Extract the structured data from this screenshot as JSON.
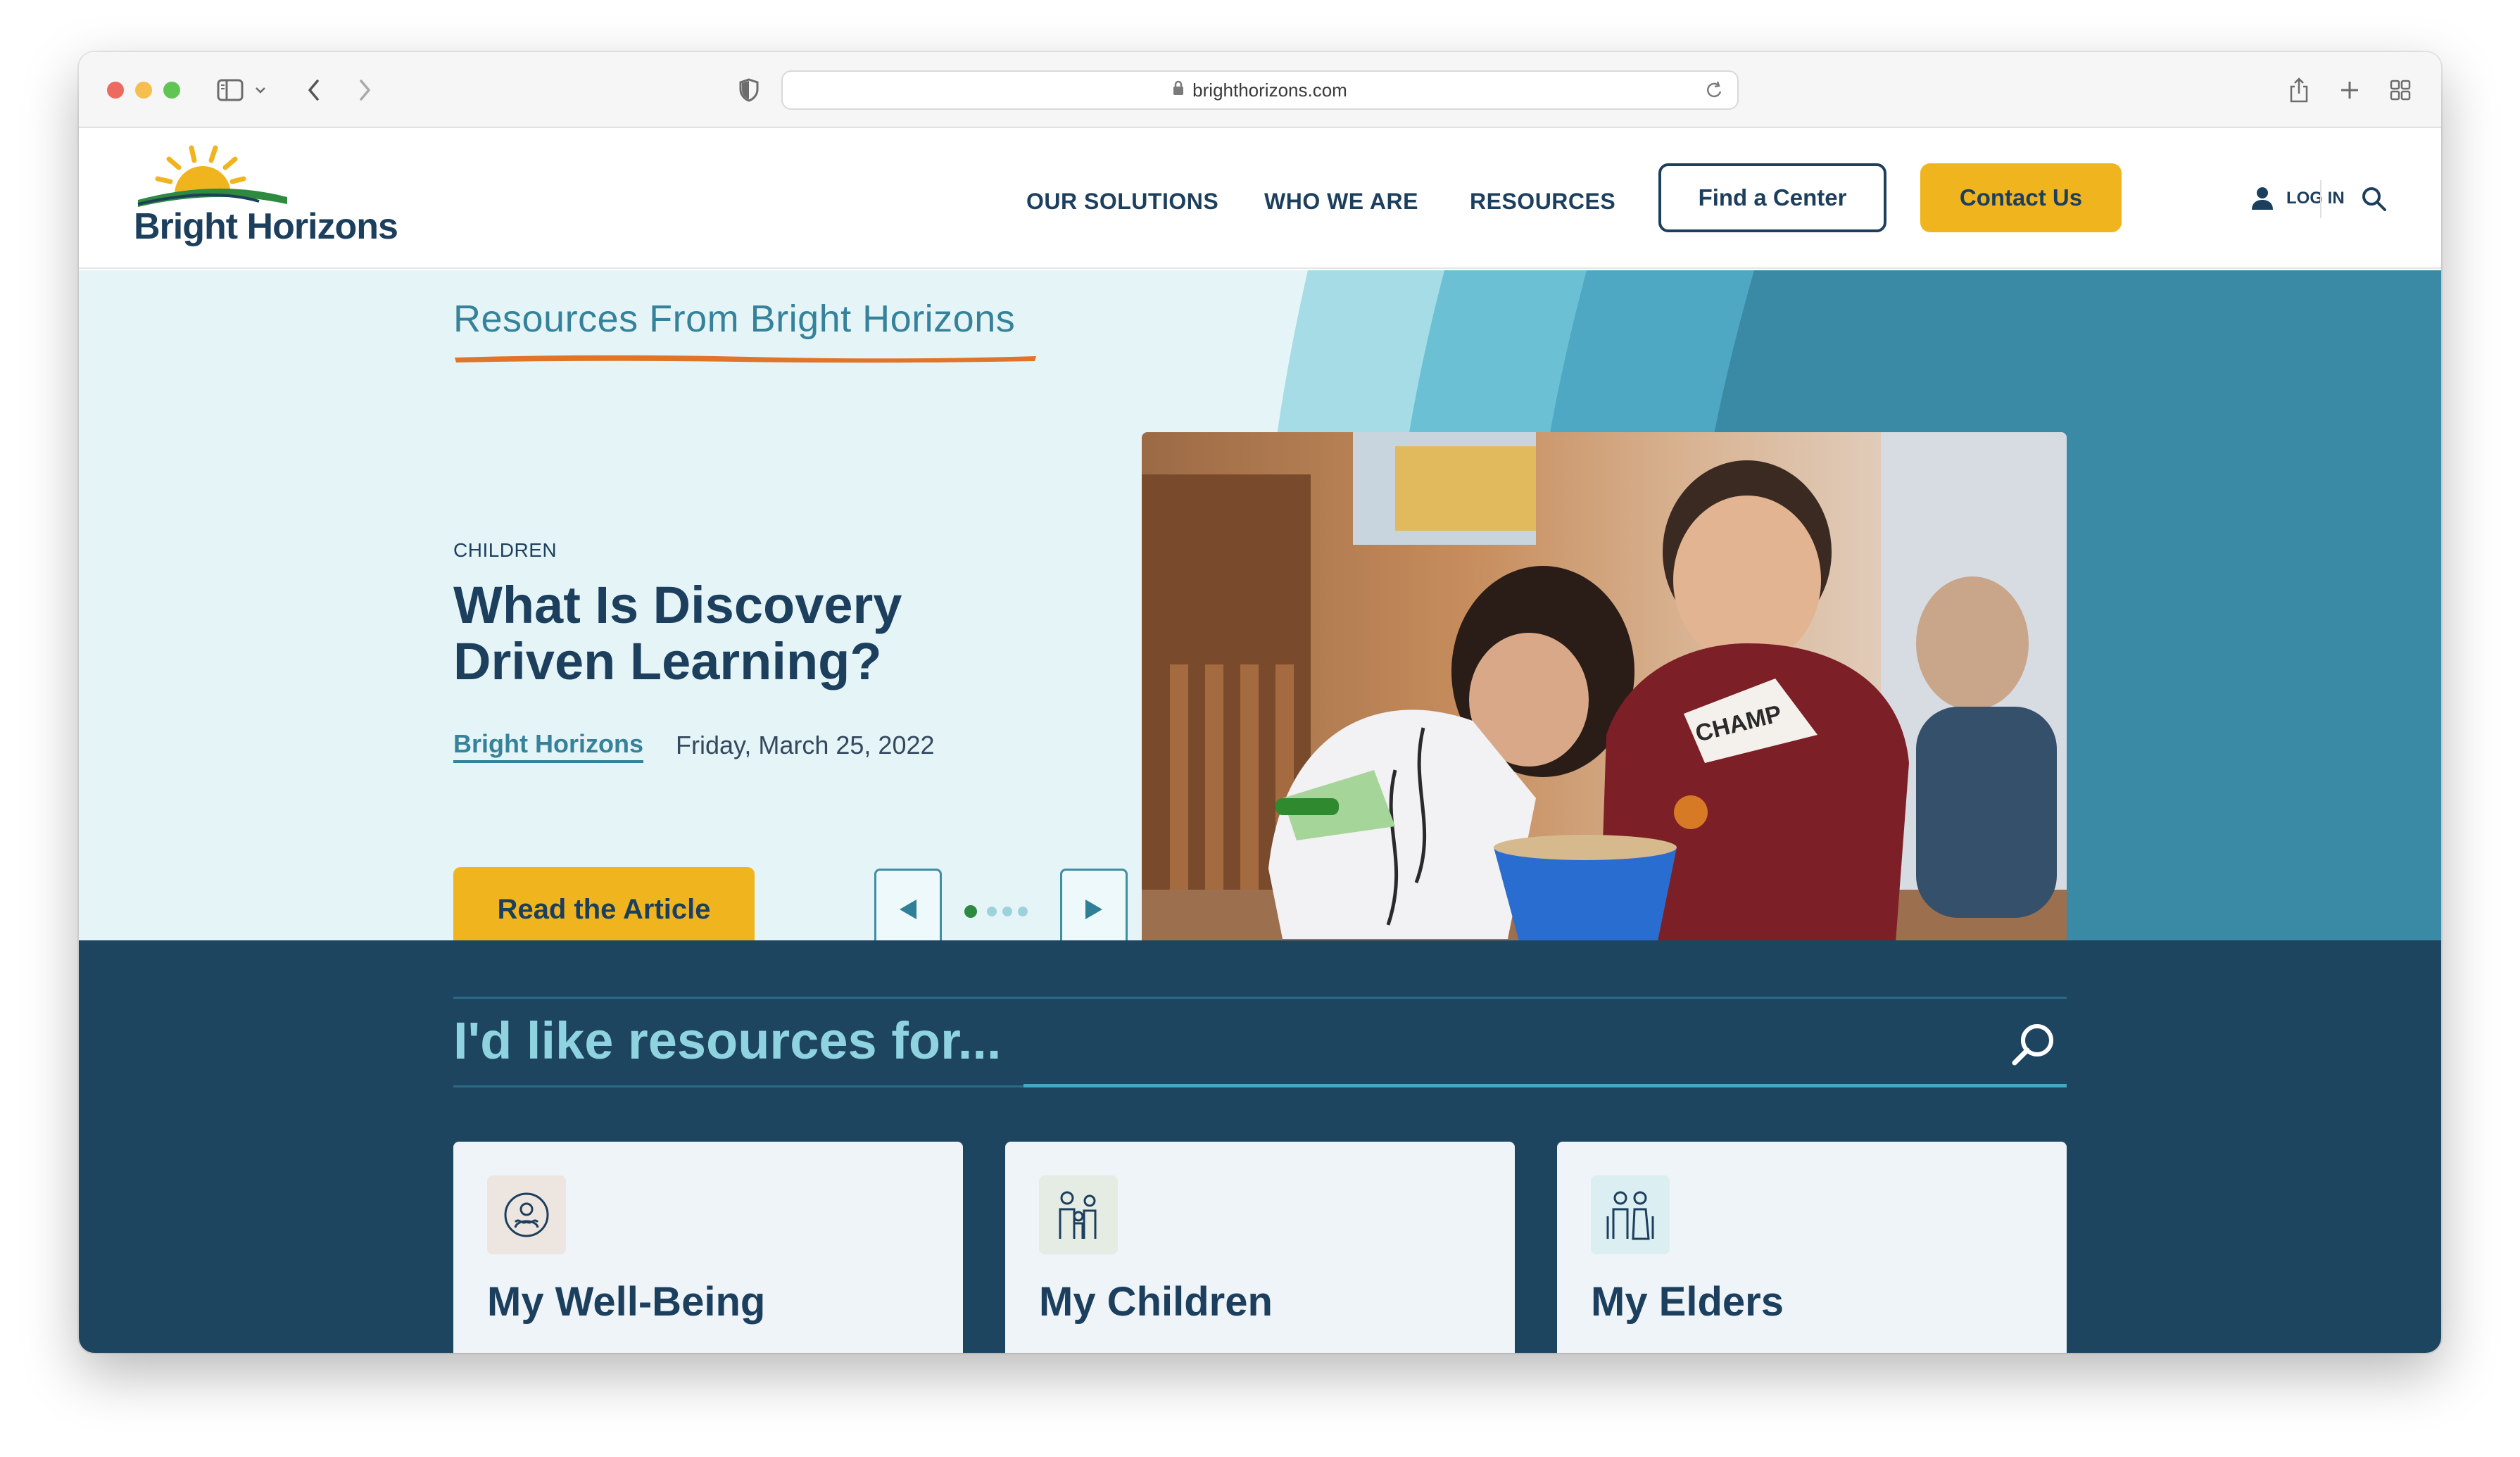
{
  "browser": {
    "url": "brighthorizons.com"
  },
  "header": {
    "logo_text": "Bright Horizons",
    "nav": [
      "OUR SOLUTIONS",
      "WHO WE ARE",
      "RESOURCES"
    ],
    "find_center": "Find a Center",
    "contact_us": "Contact Us",
    "login": "LOG IN"
  },
  "hero": {
    "heading": "Resources From Bright Horizons",
    "category": "CHILDREN",
    "title": "What Is Discovery Driven Learning?",
    "author": "Bright Horizons",
    "date": "Friday, March 25, 2022",
    "cta": "Read the Article",
    "photo_shirt_text": "CHAMP",
    "carousel": {
      "slides": 4,
      "active": 1
    }
  },
  "resources": {
    "heading": "I'd like resources for...",
    "cards": [
      {
        "title": "My Well-Being",
        "icon": "wellbeing-icon"
      },
      {
        "title": "My Children",
        "icon": "children-icon"
      },
      {
        "title": "My Elders",
        "icon": "elders-icon"
      }
    ]
  },
  "colors": {
    "navy": "#1d3f5e",
    "teal": "#35829a",
    "gold": "#f0b51e",
    "hero_bg": "#e5f5f7",
    "resources_bg": "#1d4560",
    "accent_orange": "#e0752a"
  }
}
